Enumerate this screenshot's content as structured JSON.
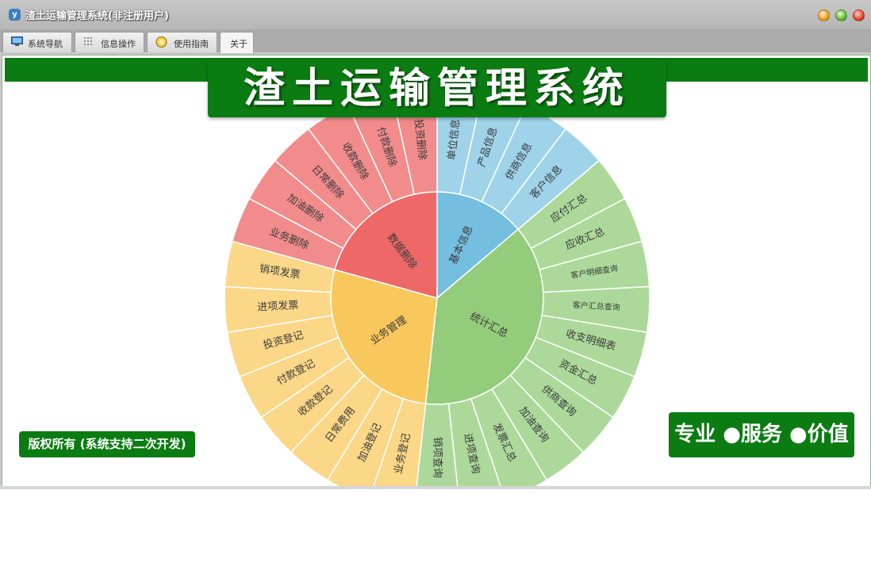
{
  "window": {
    "title": "渣土运输管理系统(非注册用户)",
    "app_icon": "app-logo-icon",
    "controls": [
      "minimize",
      "maximize",
      "close"
    ]
  },
  "tabs": [
    {
      "label": "系统导航",
      "icon": "monitor-icon"
    },
    {
      "label": "信息操作",
      "icon": "grid-icon"
    },
    {
      "label": "使用指南",
      "icon": "help-icon"
    },
    {
      "label": "关于",
      "active": true
    }
  ],
  "banner": {
    "title": "渣土运输管理系统"
  },
  "copyright": "版权所有 (系统支持二次开发)",
  "slogan": "专业 ●服务 ●价值",
  "colors": {
    "brand_green": "#0b7c12"
  },
  "sunburst": {
    "center_groups": [
      {
        "label": "基本信息",
        "color": "#74bfe0",
        "color_light": "#9ed3ea",
        "children": [
          "单位信息",
          "产品信息",
          "供商信息",
          "客户信息"
        ]
      },
      {
        "label": "统计汇总",
        "color": "#93cc7a",
        "color_light": "#acd99a",
        "children": [
          "应付汇总",
          "应收汇总",
          "客户明细查询",
          "客户汇总查询",
          "收支明细表",
          "资金汇总",
          "供商查询",
          "加油查询",
          "发票汇总",
          "进项查询",
          "销项查询"
        ]
      },
      {
        "label": "业务管理",
        "color": "#f9c85c",
        "color_light": "#fbd787",
        "children": [
          "业务登记",
          "加油登记",
          "日常费用",
          "收款登记",
          "付款登记",
          "投资登记",
          "进项发票",
          "销项发票"
        ]
      },
      {
        "label": "数据删除",
        "color": "#ee6868",
        "color_light": "#f28c8c",
        "children": [
          "业务删除",
          "加油删除",
          "日常删除",
          "收款删除",
          "付款删除",
          "投资删除"
        ]
      }
    ]
  }
}
